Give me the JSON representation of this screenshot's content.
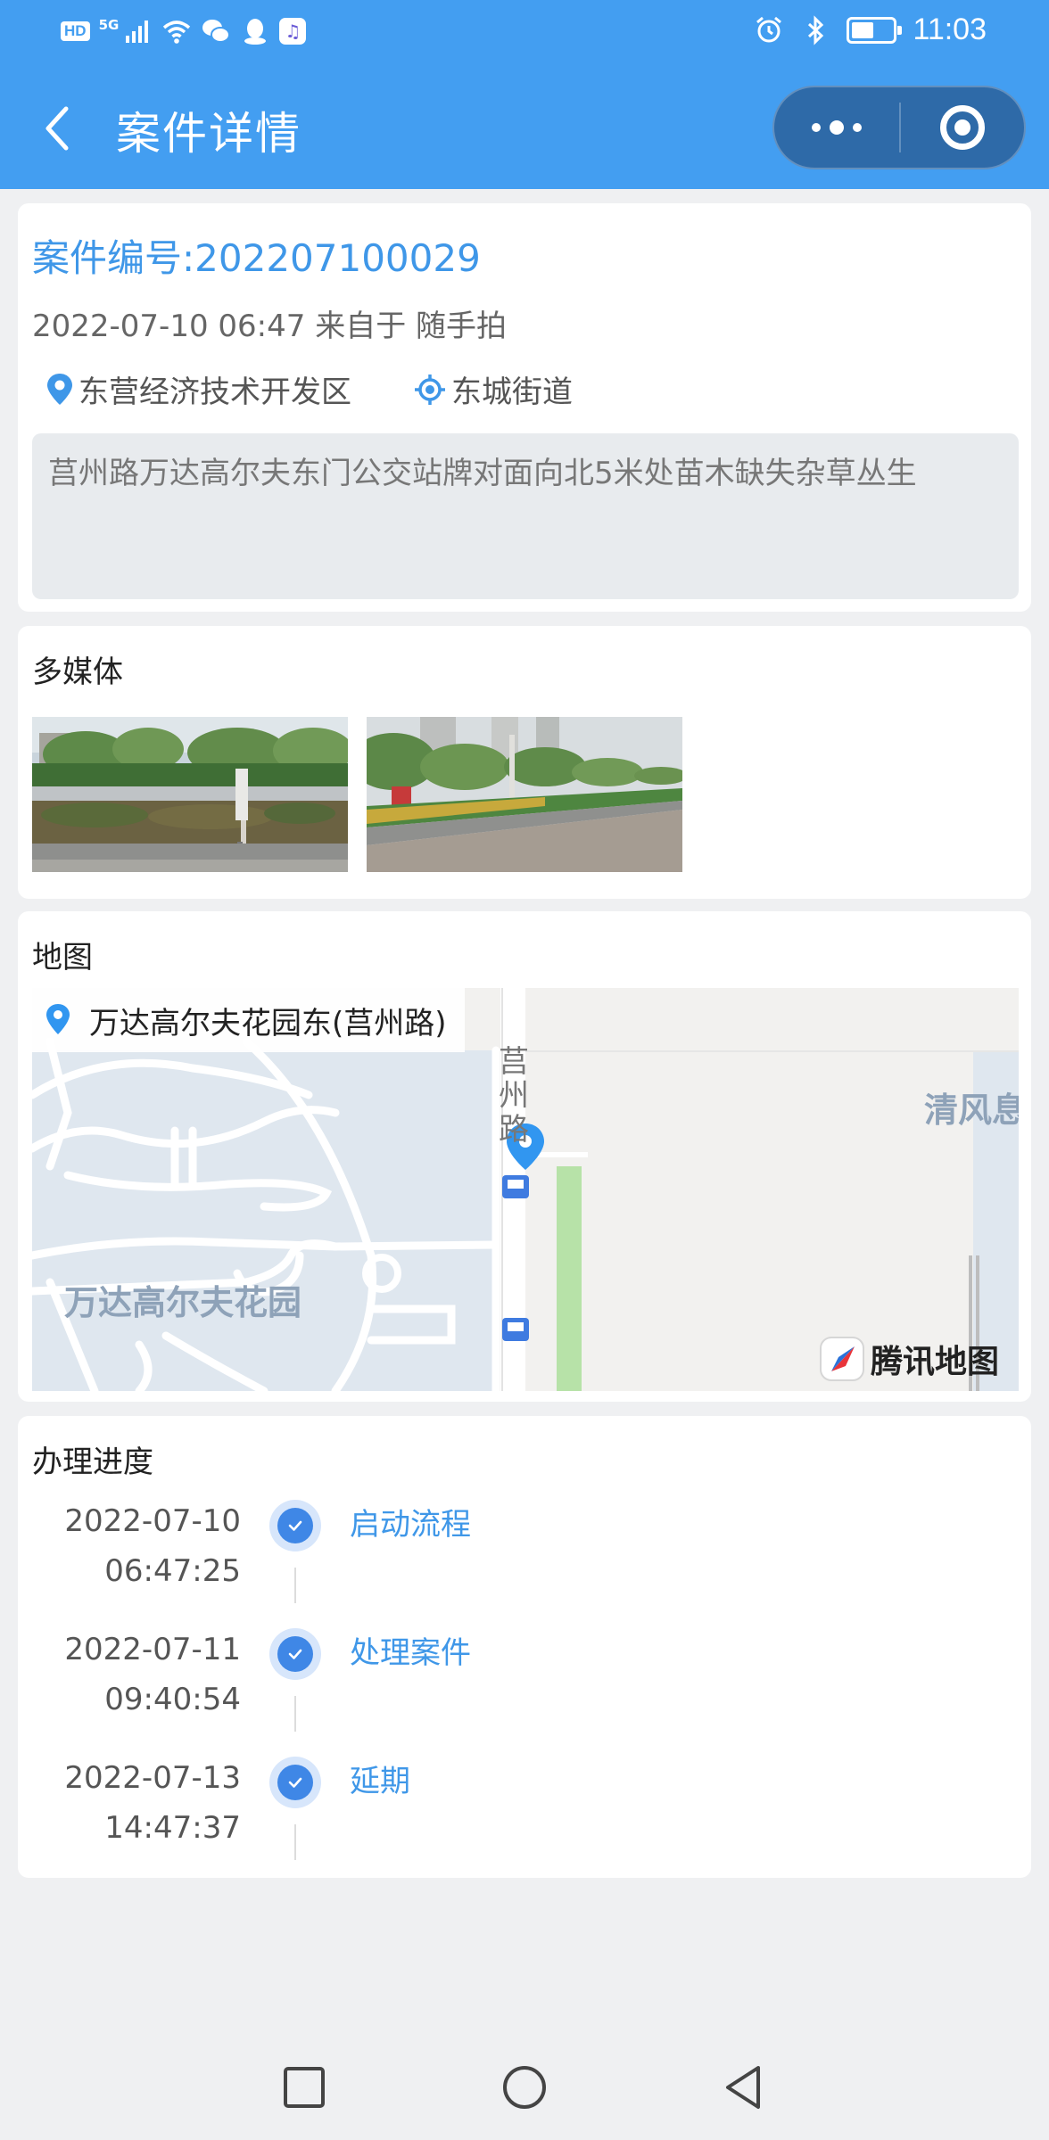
{
  "status_bar": {
    "hd": "HD",
    "network": "5G",
    "time": "11:03",
    "battery_level": 0.55
  },
  "header": {
    "title": "案件详情"
  },
  "case": {
    "number": "案件编号:202207100029",
    "meta": "2022-07-10 06:47 来自于 随手拍",
    "district": "东营经济技术开发区",
    "street": "东城街道",
    "description": "莒州路万达高尔夫东门公交站牌对面向北5米处苗木缺失杂草丛生"
  },
  "media": {
    "title": "多媒体",
    "photo_count": 2
  },
  "map": {
    "title": "地图",
    "address": "万达高尔夫花园东(莒州路)",
    "labels": {
      "road": "莒州路",
      "area": "万达高尔夫花园",
      "right": "清风息"
    },
    "provider": "腾讯地图"
  },
  "progress": {
    "title": "办理进度",
    "steps": [
      {
        "date": "2022-07-10",
        "time": "06:47:25",
        "label": "启动流程"
      },
      {
        "date": "2022-07-11",
        "time": "09:40:54",
        "label": "处理案件"
      },
      {
        "date": "2022-07-13",
        "time": "14:47:37",
        "label": "延期"
      }
    ]
  },
  "colors": {
    "brand": "#439ef1",
    "accent": "#3f97e8",
    "check": "#3f87e6"
  },
  "icons": {
    "back": "chevron-left-icon",
    "more": "more-dots-icon",
    "close": "target-circle-icon",
    "location": "location-pin-icon",
    "street": "locate-icon",
    "check": "check-icon"
  }
}
